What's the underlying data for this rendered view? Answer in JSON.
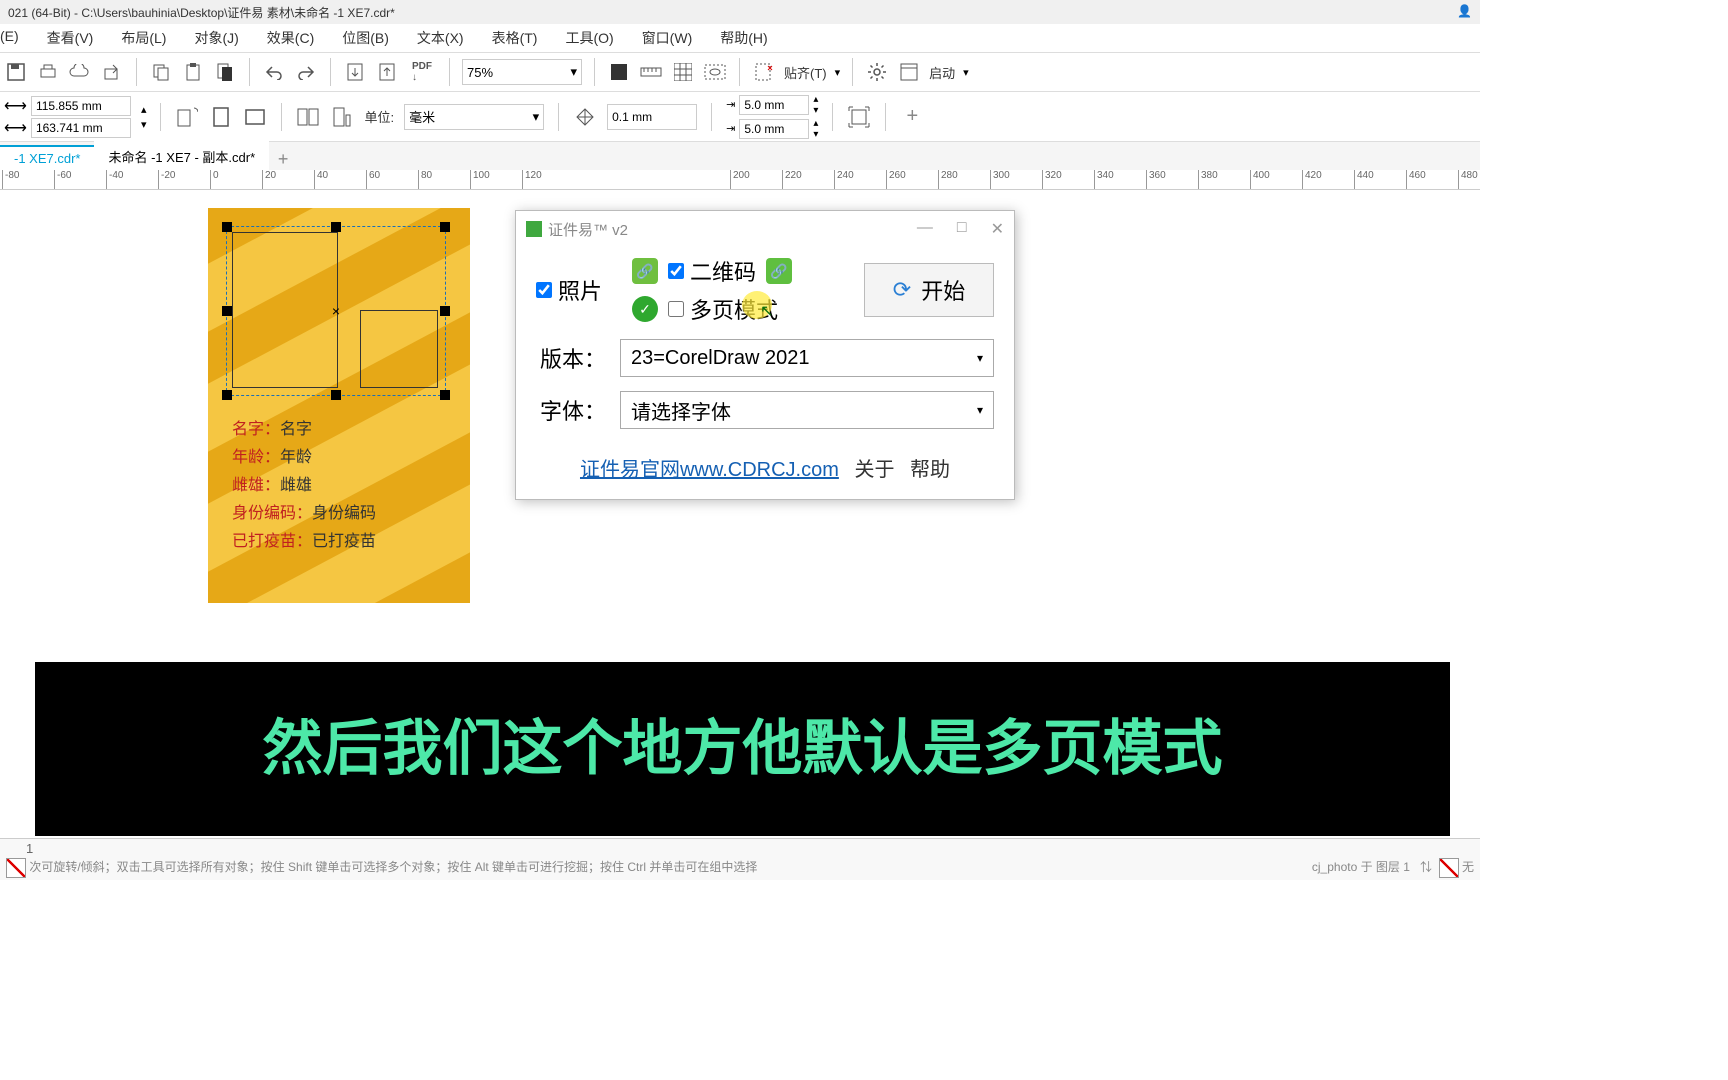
{
  "title": "021 (64-Bit) - C:\\Users\\bauhinia\\Desktop\\证件易 素材\\未命名 -1 XE7.cdr*",
  "menu": [
    "(E)",
    "查看(V)",
    "布局(L)",
    "对象(J)",
    "效果(C)",
    "位图(B)",
    "文本(X)",
    "表格(T)",
    "工具(O)",
    "窗口(W)",
    "帮助(H)"
  ],
  "zoom": "75%",
  "snap": "贴齐(T)",
  "launch": "启动",
  "dims": {
    "w": "115.855 mm",
    "h": "163.741 mm"
  },
  "unit_label": "单位:",
  "unit_value": "毫米",
  "nudge": "0.1 mm",
  "dup": {
    "x": "5.0 mm",
    "y": "5.0 mm"
  },
  "tabs": [
    "-1 XE7.cdr*",
    "未命名 -1 XE7 - 副本.cdr*"
  ],
  "ruler_ticks": [
    -80,
    -60,
    -40,
    -20,
    0,
    20,
    40,
    60,
    80,
    100,
    120,
    200,
    220,
    240,
    260,
    280,
    300,
    320,
    340,
    360,
    380,
    400,
    420,
    440,
    460,
    480
  ],
  "card_fields": [
    {
      "lbl": "名字：",
      "val": "名字"
    },
    {
      "lbl": "年龄：",
      "val": "年龄"
    },
    {
      "lbl": "雌雄：",
      "val": "雌雄"
    },
    {
      "lbl": "身份编码：",
      "val": "身份编码"
    },
    {
      "lbl": "已打疫苗：",
      "val": "已打疫苗"
    }
  ],
  "dialog": {
    "title": "证件易™ v2",
    "chk_photo": "照片",
    "chk_qr": "二维码",
    "chk_multi": "多页模式",
    "start": "开始",
    "ver_lbl": "版本：",
    "ver_val": "23=CorelDraw 2021",
    "font_lbl": "字体：",
    "font_val": "请选择字体",
    "link": "证件易官网www.CDRCJ.com",
    "about": "关于",
    "help": "帮助"
  },
  "subtitle": "然后我们这个地方他默认是多页模式",
  "status_page": "1",
  "status_hint": "次可旋转/倾斜；双击工具可选择所有对象；按住 Shift 键单击可选择多个对象；按住 Alt 键单击可进行挖掘；按住 Ctrl 并单击可在组中选择",
  "status_obj": "cj_photo 于 图层 1",
  "status_fill": "无"
}
